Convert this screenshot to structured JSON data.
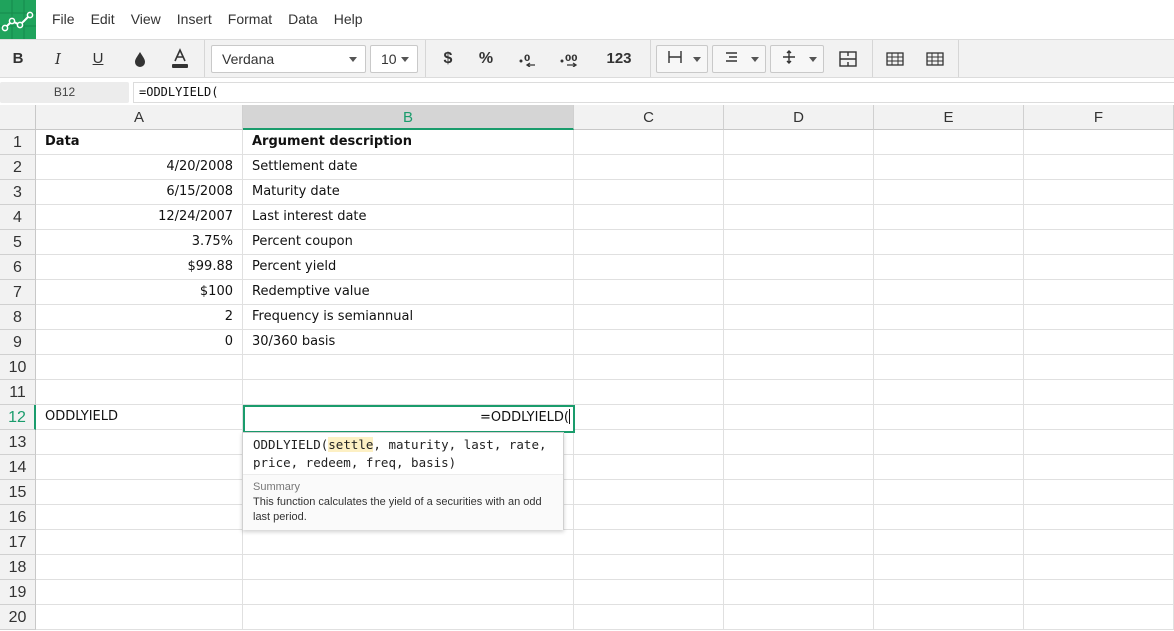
{
  "menu": [
    "File",
    "Edit",
    "View",
    "Insert",
    "Format",
    "Data",
    "Help"
  ],
  "toolbar": {
    "bold": "B",
    "italic": "I",
    "underline": "U",
    "font": "Verdana",
    "font_size": "10",
    "currency": "$",
    "percent": "%",
    "number_format": "123"
  },
  "formula_bar": {
    "cell_ref": "B12",
    "content": "=ODDLYIELD("
  },
  "columns": [
    "A",
    "B",
    "C",
    "D",
    "E",
    "F"
  ],
  "rows": [
    "1",
    "2",
    "3",
    "4",
    "5",
    "6",
    "7",
    "8",
    "9",
    "10",
    "11",
    "12",
    "13",
    "14",
    "15",
    "16",
    "17",
    "18",
    "19",
    "20"
  ],
  "cells": {
    "A1": "Data",
    "B1": "Argument description",
    "A2": "4/20/2008",
    "B2": "Settlement date",
    "A3": "6/15/2008",
    "B3": "Maturity date",
    "A4": "12/24/2007",
    "B4": "Last interest date",
    "A5": "3.75%",
    "B5": "Percent coupon",
    "A6": "$99.88",
    "B6": "Percent yield",
    "A7": "$100",
    "B7": "Redemptive value",
    "A8": "2",
    "B8": "Frequency is semiannual",
    "A9": "0",
    "B9": "30/360 basis",
    "A12": "ODDLYIELD"
  },
  "editor": {
    "value": "=ODDLYIELD("
  },
  "autocomplete": {
    "fn": "ODDLYIELD(",
    "highlighted_arg": "settle",
    "rest_line1": ", maturity, last, rate,",
    "line2": "price, redeem, freq, basis)",
    "summary_title": "Summary",
    "summary_text": "This function calculates the yield of a securities with an odd last period."
  },
  "colors": {
    "accent": "#1a9c6c",
    "logo": "#1fa35c",
    "highlight": "#fdf0c4"
  }
}
